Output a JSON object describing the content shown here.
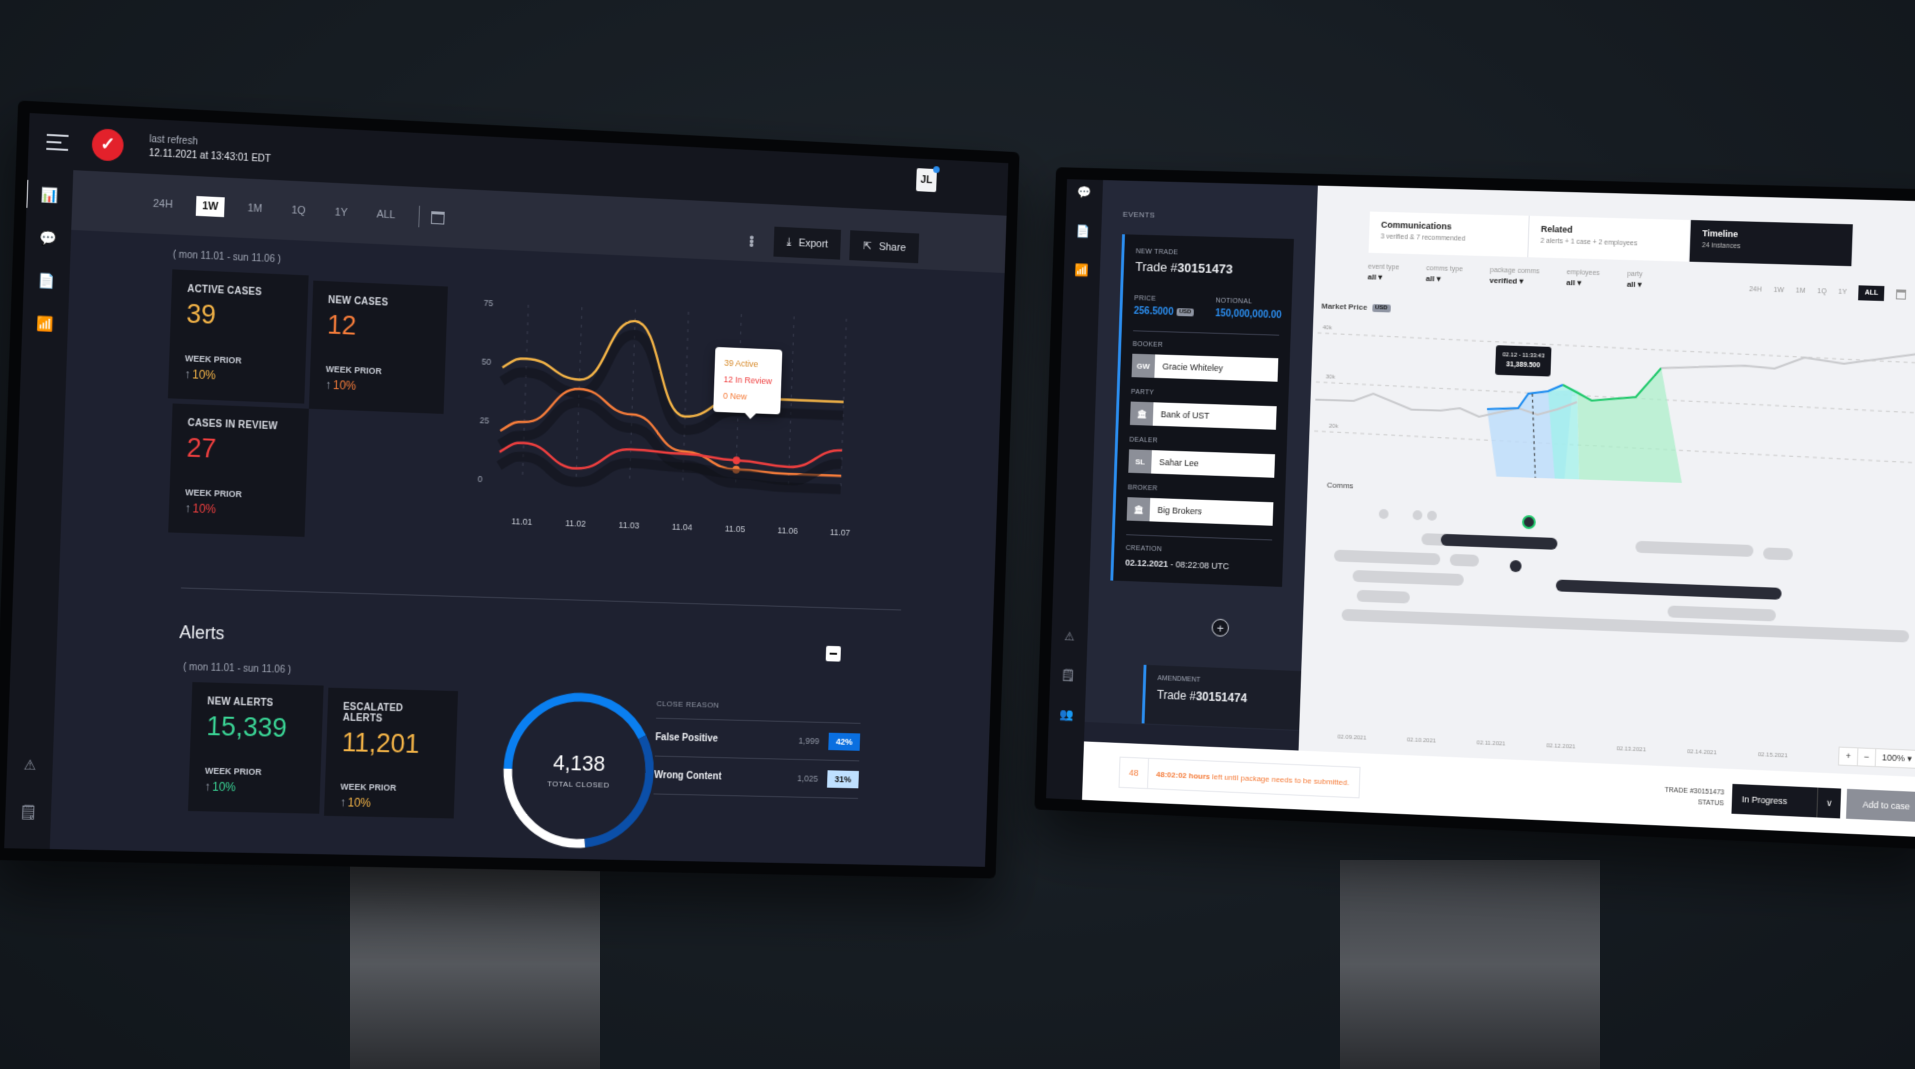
{
  "left": {
    "header": {
      "refresh_label": "last refresh",
      "refresh_time": "12.11.2021 at 13:43:01 EDT",
      "avatar": "JL"
    },
    "ranges": [
      "24H",
      "1W",
      "1M",
      "1Q",
      "1Y",
      "ALL"
    ],
    "selected_range": "1W",
    "actions": {
      "export": "Export",
      "share": "Share"
    },
    "date_range": "( mon 11.01 - sun 11.06 )",
    "cases": [
      {
        "label": "ACTIVE CASES",
        "value": "39",
        "prior_label": "WEEK PRIOR",
        "prior": "10%",
        "color": "#f4b447"
      },
      {
        "label": "NEW CASES",
        "value": "12",
        "prior_label": "WEEK PRIOR",
        "prior": "10%",
        "color": "#f57c3a"
      },
      {
        "label": "CASES IN REVIEW",
        "value": "27",
        "prior_label": "WEEK PRIOR",
        "prior": "10%",
        "color": "#ef3f3f"
      }
    ],
    "tooltip": {
      "active": "39 Active",
      "review": "12 In Review",
      "new": "0 New"
    },
    "alerts": {
      "title": "Alerts",
      "date_range": "( mon 11.01 - sun 11.06 )",
      "cards": [
        {
          "label": "NEW ALERTS",
          "value": "15,339",
          "prior_label": "WEEK PRIOR",
          "prior": "10%",
          "color": "#3ad495"
        },
        {
          "label": "ESCALATED ALERTS",
          "value": "11,201",
          "prior_label": "WEEK PRIOR",
          "prior": "10%",
          "color": "#f4b447"
        }
      ],
      "total_closed": "4,138",
      "total_closed_label": "TOTAL CLOSED",
      "close_reason_label": "CLOSE REASON",
      "close_reasons": [
        {
          "name": "False Positive",
          "count": "1,999",
          "pct": "42%",
          "bg": "#0a6fe0",
          "fg": "#ffffff"
        },
        {
          "name": "Wrong Content",
          "count": "1,025",
          "pct": "31%",
          "bg": "#bfe0ff",
          "fg": "#111111"
        }
      ]
    }
  },
  "chart_data": {
    "type": "line",
    "x": [
      "11.01",
      "11.02",
      "11.03",
      "11.04",
      "11.05",
      "11.06",
      "11.07"
    ],
    "ylim": [
      0,
      75
    ],
    "yticks": [
      0,
      25,
      50,
      75
    ],
    "series": [
      {
        "name": "Active",
        "color": "#f4b447",
        "values": [
          52,
          44,
          70,
          30,
          39,
          39,
          39
        ]
      },
      {
        "name": "In Review",
        "color": "#f57c3a",
        "values": [
          25,
          40,
          30,
          15,
          8,
          7,
          7
        ]
      },
      {
        "name": "New",
        "color": "#ef3f3f",
        "values": [
          16,
          6,
          15,
          14,
          12,
          10,
          18
        ]
      }
    ],
    "title": "",
    "xlabel": "",
    "ylabel": ""
  },
  "right": {
    "events_label": "EVENTS",
    "event": {
      "type": "NEW TRADE",
      "trade_prefix": "Trade #",
      "trade_no": "30151473",
      "price_label": "PRICE",
      "price": "256.5000",
      "currency": "USD",
      "notional_label": "NOTIONAL",
      "notional": "150,000,000.00",
      "people": [
        {
          "role": "BOOKER",
          "initials": "GW",
          "name": "Gracie Whiteley"
        },
        {
          "role": "PARTY",
          "initials": "🏛",
          "name": "Bank of UST"
        },
        {
          "role": "DEALER",
          "initials": "SL",
          "name": "Sahar Lee"
        },
        {
          "role": "BROKER",
          "initials": "🏛",
          "name": "Big Brokers"
        }
      ],
      "creation_label": "CREATION",
      "creation_date": "02.12.2021",
      "creation_time": " - 08:22:08 UTC"
    },
    "amendment": {
      "type": "AMENDMENT",
      "trade_prefix": "Trade #",
      "trade_no": "30151474"
    },
    "tabs": [
      {
        "title": "Communications",
        "sub": "3 verified & 7 recommended"
      },
      {
        "title": "Related",
        "sub": "2 alerts + 1 case + 2 employees"
      },
      {
        "title": "Timeline",
        "sub": "24 instances"
      }
    ],
    "filters": [
      {
        "label": "event type",
        "value": "all ▾"
      },
      {
        "label": "comms type",
        "value": "all ▾"
      },
      {
        "label": "package comms",
        "value": "verified ▾"
      },
      {
        "label": "employees",
        "value": "all ▾"
      },
      {
        "label": "party",
        "value": "all ▾"
      }
    ],
    "ranges": [
      "24H",
      "1W",
      "1M",
      "1Q",
      "1Y",
      "ALL"
    ],
    "selected_range": "ALL",
    "market_price_label": "Market Price",
    "yticks": [
      "40k",
      "30k",
      "20k"
    ],
    "tooltip": {
      "time": "02.12 - 11:33:43",
      "value": "31,389.500"
    },
    "comms_label": "Comms",
    "dates": [
      "02.09.2021",
      "02.10.2021",
      "02.11.2021",
      "02.12.2021",
      "02.13.2021",
      "02.14.2021",
      "02.15.2021"
    ],
    "zoom": {
      "plus": "+",
      "minus": "−",
      "level": "100% ▾"
    },
    "footer": {
      "icon": "48",
      "hours": "48:02:02 hours",
      "message": " left until package needs to be submitted.",
      "trade_label": "TRADE #30151473",
      "status_label": "STATUS",
      "status": "In Progress",
      "add_to_case": "Add to case"
    }
  }
}
